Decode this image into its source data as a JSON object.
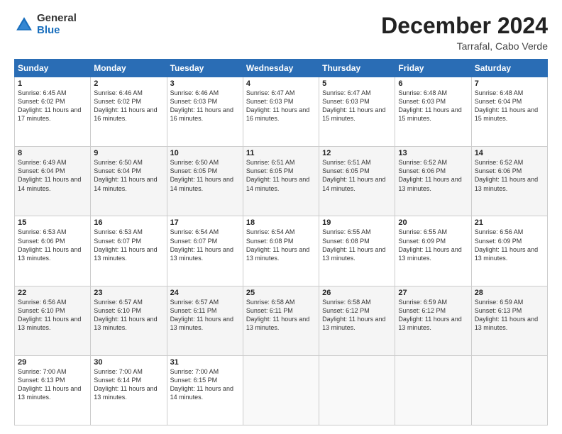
{
  "logo": {
    "general": "General",
    "blue": "Blue"
  },
  "header": {
    "month": "December 2024",
    "location": "Tarrafal, Cabo Verde"
  },
  "weekdays": [
    "Sunday",
    "Monday",
    "Tuesday",
    "Wednesday",
    "Thursday",
    "Friday",
    "Saturday"
  ],
  "weeks": [
    [
      {
        "day": "1",
        "sunrise": "6:45 AM",
        "sunset": "6:02 PM",
        "daylight": "11 hours and 17 minutes."
      },
      {
        "day": "2",
        "sunrise": "6:46 AM",
        "sunset": "6:02 PM",
        "daylight": "11 hours and 16 minutes."
      },
      {
        "day": "3",
        "sunrise": "6:46 AM",
        "sunset": "6:03 PM",
        "daylight": "11 hours and 16 minutes."
      },
      {
        "day": "4",
        "sunrise": "6:47 AM",
        "sunset": "6:03 PM",
        "daylight": "11 hours and 16 minutes."
      },
      {
        "day": "5",
        "sunrise": "6:47 AM",
        "sunset": "6:03 PM",
        "daylight": "11 hours and 15 minutes."
      },
      {
        "day": "6",
        "sunrise": "6:48 AM",
        "sunset": "6:03 PM",
        "daylight": "11 hours and 15 minutes."
      },
      {
        "day": "7",
        "sunrise": "6:48 AM",
        "sunset": "6:04 PM",
        "daylight": "11 hours and 15 minutes."
      }
    ],
    [
      {
        "day": "8",
        "sunrise": "6:49 AM",
        "sunset": "6:04 PM",
        "daylight": "11 hours and 14 minutes."
      },
      {
        "day": "9",
        "sunrise": "6:50 AM",
        "sunset": "6:04 PM",
        "daylight": "11 hours and 14 minutes."
      },
      {
        "day": "10",
        "sunrise": "6:50 AM",
        "sunset": "6:05 PM",
        "daylight": "11 hours and 14 minutes."
      },
      {
        "day": "11",
        "sunrise": "6:51 AM",
        "sunset": "6:05 PM",
        "daylight": "11 hours and 14 minutes."
      },
      {
        "day": "12",
        "sunrise": "6:51 AM",
        "sunset": "6:05 PM",
        "daylight": "11 hours and 14 minutes."
      },
      {
        "day": "13",
        "sunrise": "6:52 AM",
        "sunset": "6:06 PM",
        "daylight": "11 hours and 13 minutes."
      },
      {
        "day": "14",
        "sunrise": "6:52 AM",
        "sunset": "6:06 PM",
        "daylight": "11 hours and 13 minutes."
      }
    ],
    [
      {
        "day": "15",
        "sunrise": "6:53 AM",
        "sunset": "6:06 PM",
        "daylight": "11 hours and 13 minutes."
      },
      {
        "day": "16",
        "sunrise": "6:53 AM",
        "sunset": "6:07 PM",
        "daylight": "11 hours and 13 minutes."
      },
      {
        "day": "17",
        "sunrise": "6:54 AM",
        "sunset": "6:07 PM",
        "daylight": "11 hours and 13 minutes."
      },
      {
        "day": "18",
        "sunrise": "6:54 AM",
        "sunset": "6:08 PM",
        "daylight": "11 hours and 13 minutes."
      },
      {
        "day": "19",
        "sunrise": "6:55 AM",
        "sunset": "6:08 PM",
        "daylight": "11 hours and 13 minutes."
      },
      {
        "day": "20",
        "sunrise": "6:55 AM",
        "sunset": "6:09 PM",
        "daylight": "11 hours and 13 minutes."
      },
      {
        "day": "21",
        "sunrise": "6:56 AM",
        "sunset": "6:09 PM",
        "daylight": "11 hours and 13 minutes."
      }
    ],
    [
      {
        "day": "22",
        "sunrise": "6:56 AM",
        "sunset": "6:10 PM",
        "daylight": "11 hours and 13 minutes."
      },
      {
        "day": "23",
        "sunrise": "6:57 AM",
        "sunset": "6:10 PM",
        "daylight": "11 hours and 13 minutes."
      },
      {
        "day": "24",
        "sunrise": "6:57 AM",
        "sunset": "6:11 PM",
        "daylight": "11 hours and 13 minutes."
      },
      {
        "day": "25",
        "sunrise": "6:58 AM",
        "sunset": "6:11 PM",
        "daylight": "11 hours and 13 minutes."
      },
      {
        "day": "26",
        "sunrise": "6:58 AM",
        "sunset": "6:12 PM",
        "daylight": "11 hours and 13 minutes."
      },
      {
        "day": "27",
        "sunrise": "6:59 AM",
        "sunset": "6:12 PM",
        "daylight": "11 hours and 13 minutes."
      },
      {
        "day": "28",
        "sunrise": "6:59 AM",
        "sunset": "6:13 PM",
        "daylight": "11 hours and 13 minutes."
      }
    ],
    [
      {
        "day": "29",
        "sunrise": "7:00 AM",
        "sunset": "6:13 PM",
        "daylight": "11 hours and 13 minutes."
      },
      {
        "day": "30",
        "sunrise": "7:00 AM",
        "sunset": "6:14 PM",
        "daylight": "11 hours and 13 minutes."
      },
      {
        "day": "31",
        "sunrise": "7:00 AM",
        "sunset": "6:15 PM",
        "daylight": "11 hours and 14 minutes."
      },
      null,
      null,
      null,
      null
    ]
  ],
  "labels": {
    "sunrise": "Sunrise:",
    "sunset": "Sunset:",
    "daylight": "Daylight:"
  }
}
